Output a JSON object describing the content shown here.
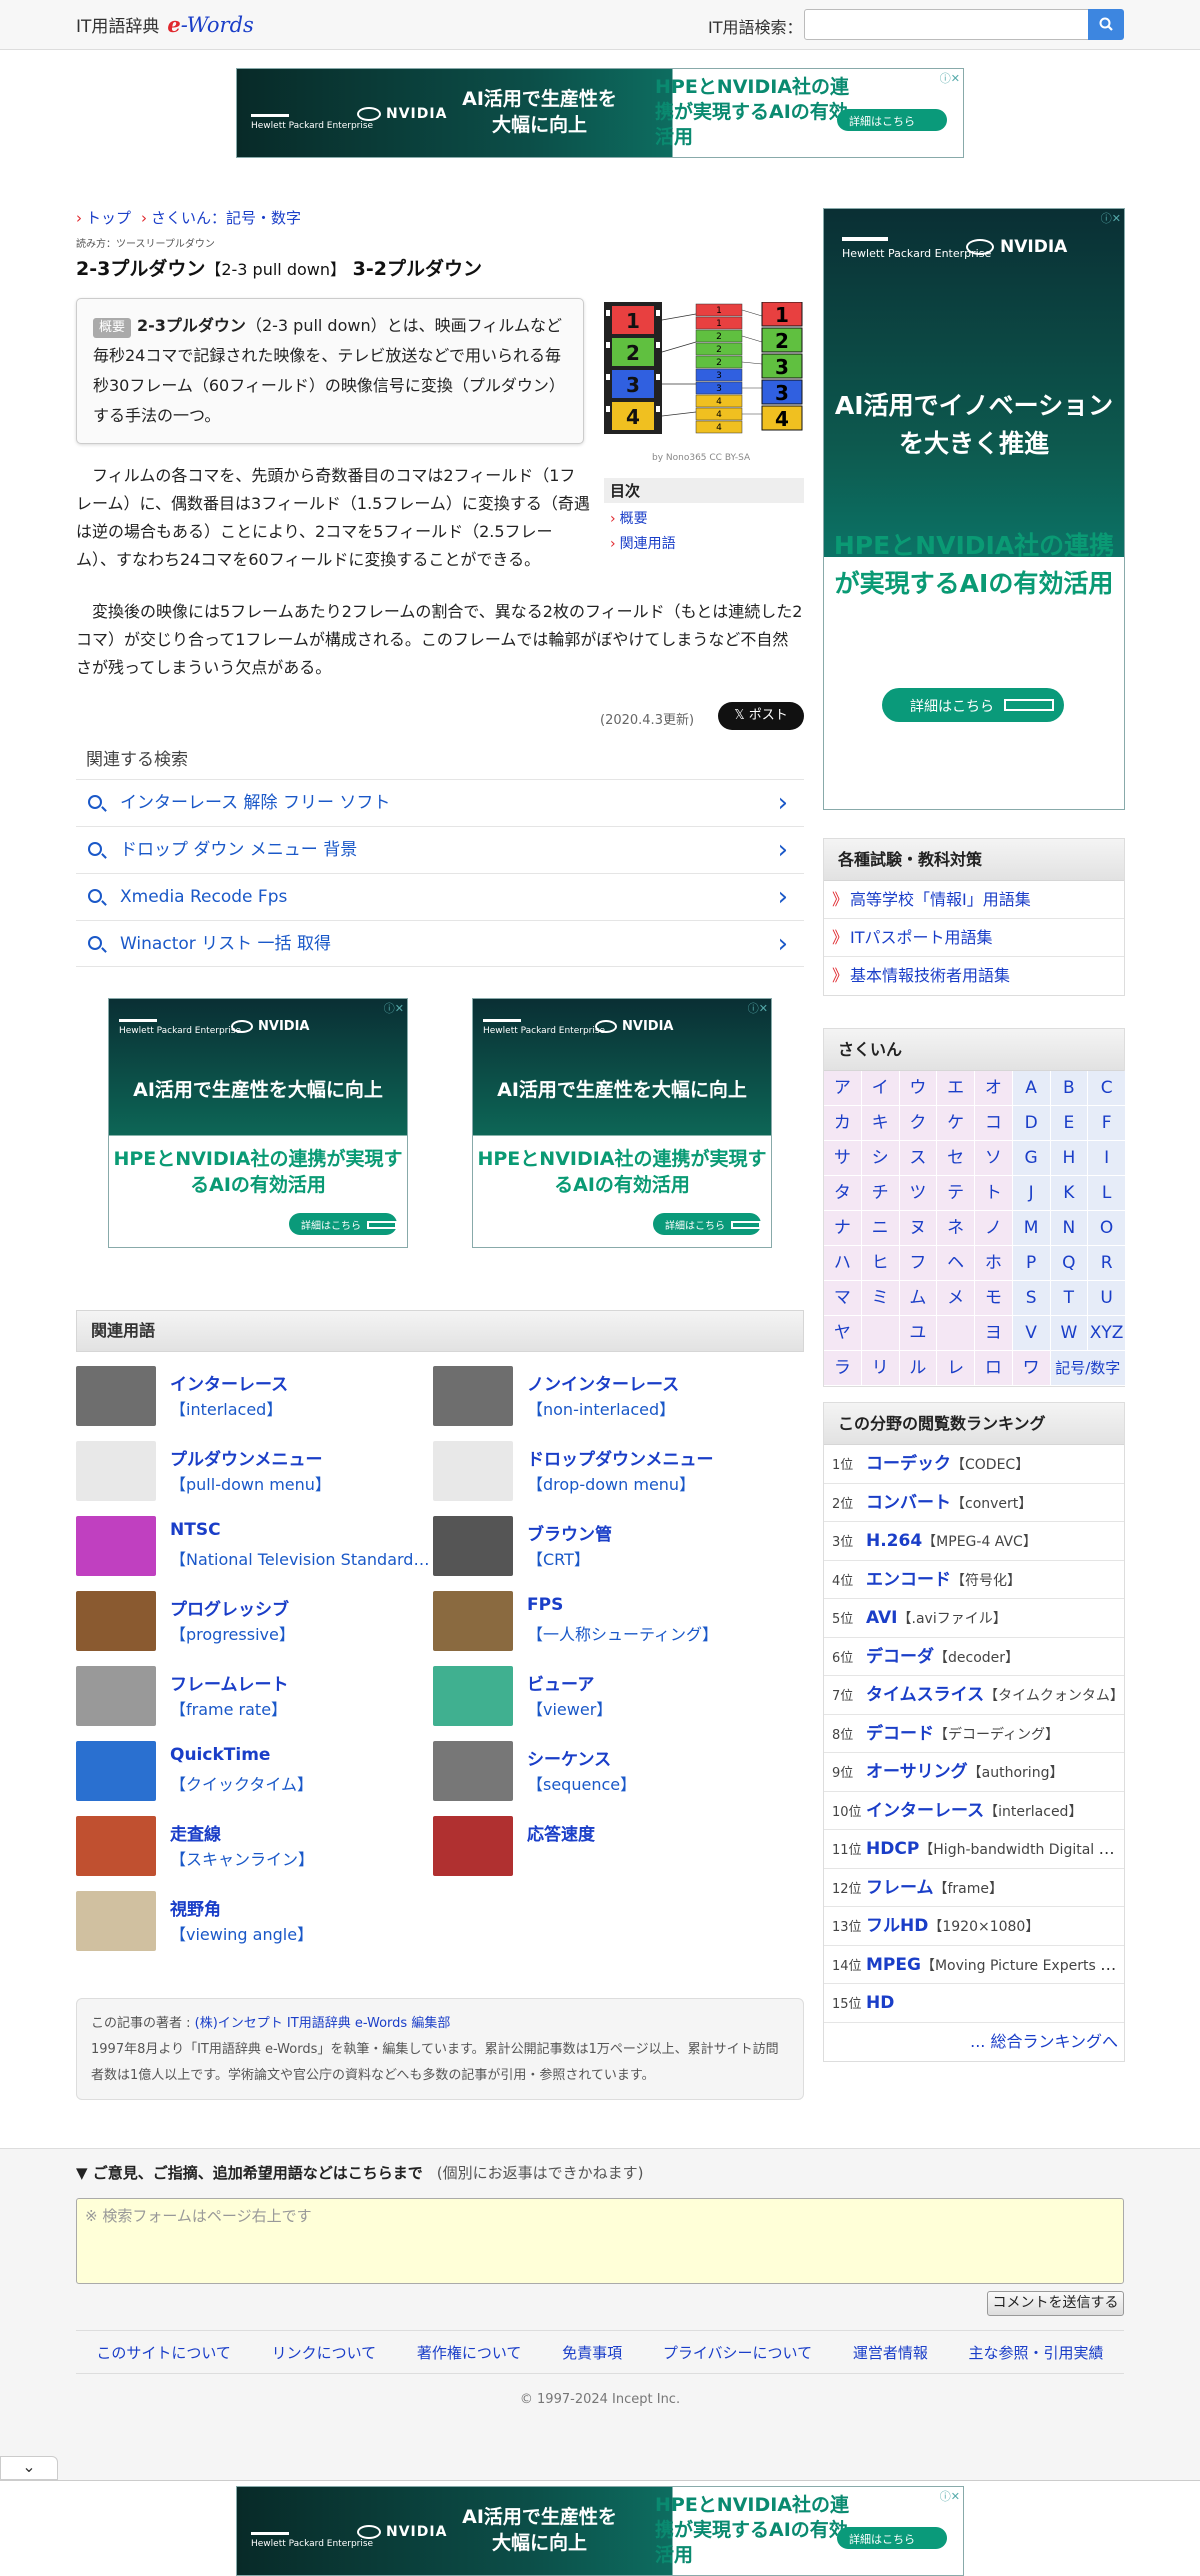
{
  "header": {
    "brand_prefix": "IT用語辞典",
    "brand_e": "e",
    "brand_words": "-Words",
    "search_label": "IT用語検索：",
    "search_placeholder": ""
  },
  "ad": {
    "hpe": "Hewlett Packard Enterprise",
    "nvidia": "NVIDIA",
    "line1": "AI活用で生産性を大幅に向上",
    "line2": "HPEとNVIDIA社の連携が実現するAIの有効活用",
    "cta": "詳細はこちら",
    "side_line1": "AI活用でイノベーションを大きく推進",
    "side_line2": "HPEとNVIDIA社の連携が実現するAIの有効活用"
  },
  "breadcrumb": [
    {
      "label": "トップ"
    },
    {
      "label": "さくいん：記号・数字"
    }
  ],
  "reading": "読み方：ツースリープルダウン",
  "title": {
    "main": "2-3プルダウン",
    "sub": "【2-3 pull down】",
    "alt": "3-2プルダウン"
  },
  "summary": {
    "tag": "概要",
    "term": "2-3プルダウン",
    "text": "（2-3 pull down）とは、映画フィルムなど毎秒24コマで記録された映像を、テレビ放送などで用いられる毎秒30フレーム（60フィールド）の映像信号に変換（プルダウン）する手法の一つ。"
  },
  "illustration_credit": "by Nono365 CC BY-SA",
  "toc": {
    "title": "目次",
    "items": [
      "概要",
      "関連用語"
    ]
  },
  "paragraphs": [
    "　フィルムの各コマを、先頭から奇数番目のコマは2フィールド（1フレーム）に、偶数番目は3フィールド（1.5フレーム）に変換する（奇遇は逆の場合もある）ことにより、2コマを5フィールド（2.5フレーム）、すなわち24コマを60フィールドに変換することができる。",
    "　変換後の映像には5フレームあたり2フレームの割合で、異なる2枚のフィールド（もとは連続した2コマ）が交じり合って1フレームが構成される。このフレームでは輪郭がぼやけてしまうなど不自然さが残ってしまういう欠点がある。"
  ],
  "updated": "(2020.4.3更新)",
  "post_button": "ポスト",
  "related_search": {
    "title": "関連する検索",
    "items": [
      "インターレース 解除 フリー ソフト",
      "ドロップ ダウン メニュー 背景",
      "Xmedia Recode Fps",
      "Winactor リスト 一括 取得"
    ]
  },
  "related_terms": {
    "title": "関連用語",
    "items": [
      {
        "name": "インターレース",
        "en": "【interlaced】",
        "color": "#6e6e6e"
      },
      {
        "name": "ノンインターレース",
        "en": "【non-interlaced】",
        "color": "#6e6e6e"
      },
      {
        "name": "プルダウンメニュー",
        "en": "【pull-down menu】",
        "color": "#e8e8e8"
      },
      {
        "name": "ドロップダウンメニュー",
        "en": "【drop-down menu】",
        "color": "#e8e8e8"
      },
      {
        "name": "NTSC",
        "en": "【National Television Standards Committee】",
        "color": "#c040c0"
      },
      {
        "name": "ブラウン管",
        "en": "【CRT】",
        "color": "#555555"
      },
      {
        "name": "プログレッシブ",
        "en": "【progressive】",
        "color": "#8a5a30"
      },
      {
        "name": "FPS",
        "en": "【一人称シューティング】",
        "color": "#8a6a40"
      },
      {
        "name": "フレームレート",
        "en": "【frame rate】",
        "color": "#999999"
      },
      {
        "name": "ビューア",
        "en": "【viewer】",
        "color": "#40b090"
      },
      {
        "name": "QuickTime",
        "en": "【クイックタイム】",
        "color": "#2a70d0"
      },
      {
        "name": "シーケンス",
        "en": "【sequence】",
        "color": "#777777"
      },
      {
        "name": "走査線",
        "en": "【スキャンライン】",
        "color": "#c05030"
      },
      {
        "name": "応答速度",
        "en": "",
        "color": "#b03030"
      },
      {
        "name": "視野角",
        "en": "【viewing angle】",
        "color": "#d0c0a0"
      }
    ]
  },
  "author": {
    "prefix": "この記事の著者 : ",
    "name": "(株)インセプト IT用語辞典 e-Words 編集部",
    "bio": "1997年8月より「IT用語辞典 e-Words」を執筆・編集しています。累計公開記事数は1万ページ以上、累計サイト訪問者数は1億人以上です。学術論文や官公庁の資料などへも多数の記事が引用・参照されています。"
  },
  "exams": {
    "title": "各種試験・教科対策",
    "items": [
      "高等学校「情報Ⅰ」用語集",
      "ITパスポート用語集",
      "基本情報技術者用語集"
    ]
  },
  "index": {
    "title": "さくいん",
    "cells": [
      "ア",
      "イ",
      "ウ",
      "エ",
      "オ",
      "A",
      "B",
      "C",
      "カ",
      "キ",
      "ク",
      "ケ",
      "コ",
      "D",
      "E",
      "F",
      "サ",
      "シ",
      "ス",
      "セ",
      "ソ",
      "G",
      "H",
      "I",
      "タ",
      "チ",
      "ツ",
      "テ",
      "ト",
      "J",
      "K",
      "L",
      "ナ",
      "ニ",
      "ヌ",
      "ネ",
      "ノ",
      "M",
      "N",
      "O",
      "ハ",
      "ヒ",
      "フ",
      "ヘ",
      "ホ",
      "P",
      "Q",
      "R",
      "マ",
      "ミ",
      "ム",
      "メ",
      "モ",
      "S",
      "T",
      "U",
      "ヤ",
      "",
      "ユ",
      "",
      "ヨ",
      "V",
      "W",
      "XYZ",
      "ラ",
      "リ",
      "ル",
      "レ",
      "ロ",
      "ワ",
      "記号/数字"
    ]
  },
  "ranking": {
    "title": "この分野の閲覧数ランキング",
    "items": [
      {
        "pos": "1位",
        "term": "コーデック",
        "en": "【CODEC】"
      },
      {
        "pos": "2位",
        "term": "コンバート",
        "en": "【convert】"
      },
      {
        "pos": "3位",
        "term": "H.264",
        "en": "【MPEG-4 AVC】"
      },
      {
        "pos": "4位",
        "term": "エンコード",
        "en": "【符号化】"
      },
      {
        "pos": "5位",
        "term": "AVI",
        "en": "【.aviファイル】"
      },
      {
        "pos": "6位",
        "term": "デコーダ",
        "en": "【decoder】"
      },
      {
        "pos": "7位",
        "term": "タイムスライス",
        "en": "【タイムクォンタム】"
      },
      {
        "pos": "8位",
        "term": "デコード",
        "en": "【デコーディング】"
      },
      {
        "pos": "9位",
        "term": "オーサリング",
        "en": "【authoring】"
      },
      {
        "pos": "10位",
        "term": "インターレース",
        "en": "【interlaced】"
      },
      {
        "pos": "11位",
        "term": "HDCP",
        "en": "【High-bandwidth Digital Content Protection】"
      },
      {
        "pos": "12位",
        "term": "フレーム",
        "en": "【frame】"
      },
      {
        "pos": "13位",
        "term": "フルHD",
        "en": "【1920×1080】"
      },
      {
        "pos": "14位",
        "term": "MPEG",
        "en": "【Moving Picture Experts Group】"
      },
      {
        "pos": "15位",
        "term": "HD",
        "en": ""
      }
    ],
    "more": "... 総合ランキングへ"
  },
  "feedback": {
    "label": "▼ ご意見、ご指摘、追加希望用語などはこちらまで",
    "note": "(個別にお返事はできかねます)",
    "placeholder": "※ 検索フォームはページ右上です",
    "send": "コメントを送信する"
  },
  "footer": {
    "links": [
      "このサイトについて",
      "リンクについて",
      "著作権について",
      "免責事項",
      "プライバシーについて",
      "運営者情報",
      "主な参照・引用実績"
    ],
    "copyright": "© 1997-2024 Incept Inc."
  },
  "collapse_symbol": "⌄"
}
